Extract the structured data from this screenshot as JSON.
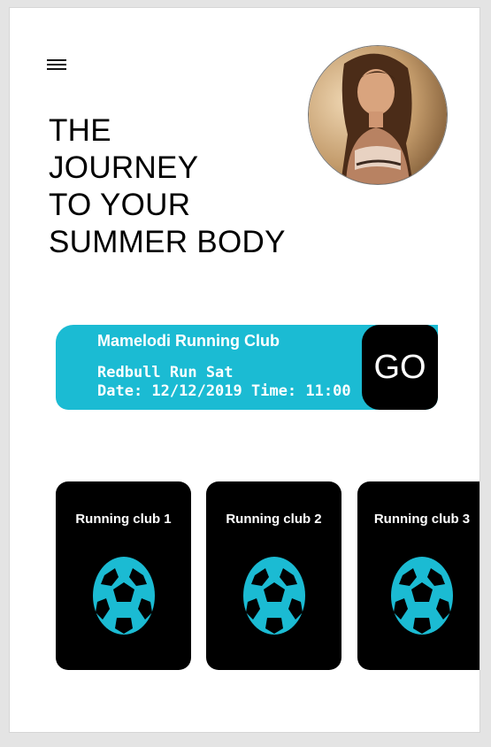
{
  "header": {
    "menu_icon": "hamburger-menu-icon",
    "avatar_icon": "user-avatar-photo"
  },
  "headline": {
    "lines": [
      "THE",
      "JOURNEY",
      "TO YOUR",
      "SUMMER BODY"
    ]
  },
  "event": {
    "club_name": "Mamelodi Running Club",
    "event_name": "Redbull Run Sat",
    "details": "Date: 12/12/2019 Time: 11:00",
    "go_label": "GO"
  },
  "clubs": [
    {
      "label": "Running club 1",
      "icon": "soccer-ball-icon"
    },
    {
      "label": "Running club 2",
      "icon": "soccer-ball-icon"
    },
    {
      "label": "Running club 3",
      "icon": "soccer-ball-icon"
    }
  ],
  "colors": {
    "accent": "#1bbbd3",
    "card": "#000000",
    "background": "#ffffff"
  }
}
